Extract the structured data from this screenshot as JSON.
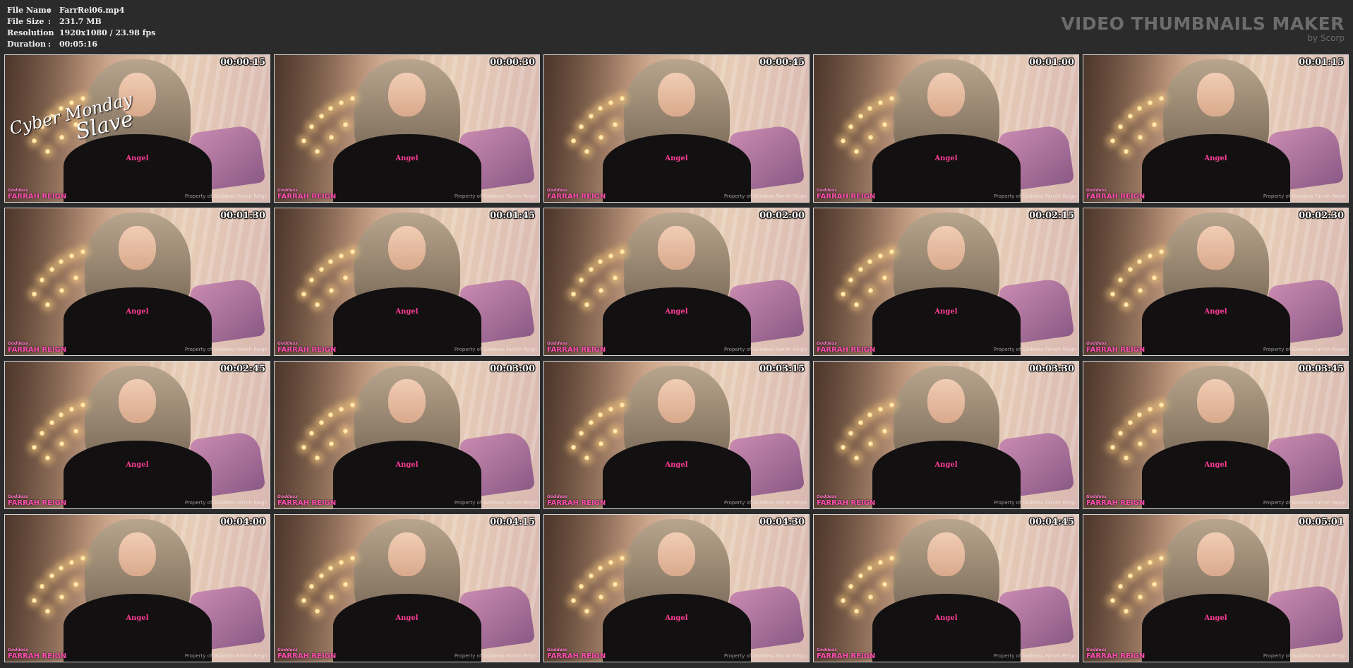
{
  "info": [
    {
      "key": "File Name",
      "sep": ":",
      "value": "FarrRei06.mp4"
    },
    {
      "key": "File Size",
      "sep": ":",
      "value": "231.7 MB"
    },
    {
      "key": "Resolution",
      "sep": ":",
      "value": "1920x1080 / 23.98 fps"
    },
    {
      "key": "Duration",
      "sep": ":",
      "value": "00:05:16"
    }
  ],
  "brand": {
    "title": "VIDEO THUMBNAILS MAKER",
    "byline": "by Scorp"
  },
  "overlay": {
    "line1": "Cyber Monday",
    "line2": "Slave"
  },
  "thumb_labels": {
    "logo_small": "Goddess",
    "logo": "FARRAH REIGN",
    "watermark": "Property of Goddess Farrah Reign",
    "shirt": "Angel"
  },
  "colors": {
    "background": "#2b2b2b",
    "timestamp": "#ffffff",
    "logo": "#ff4fb0",
    "brand": "#6c6c6c"
  },
  "thumbnails": [
    {
      "timestamp": "00:00:15"
    },
    {
      "timestamp": "00:00:30"
    },
    {
      "timestamp": "00:00:45"
    },
    {
      "timestamp": "00:01:00"
    },
    {
      "timestamp": "00:01:15"
    },
    {
      "timestamp": "00:01:30"
    },
    {
      "timestamp": "00:01:45"
    },
    {
      "timestamp": "00:02:00"
    },
    {
      "timestamp": "00:02:15"
    },
    {
      "timestamp": "00:02:30"
    },
    {
      "timestamp": "00:02:45"
    },
    {
      "timestamp": "00:03:00"
    },
    {
      "timestamp": "00:03:15"
    },
    {
      "timestamp": "00:03:30"
    },
    {
      "timestamp": "00:03:45"
    },
    {
      "timestamp": "00:04:00"
    },
    {
      "timestamp": "00:04:15"
    },
    {
      "timestamp": "00:04:30"
    },
    {
      "timestamp": "00:04:45"
    },
    {
      "timestamp": "00:05:01"
    }
  ]
}
